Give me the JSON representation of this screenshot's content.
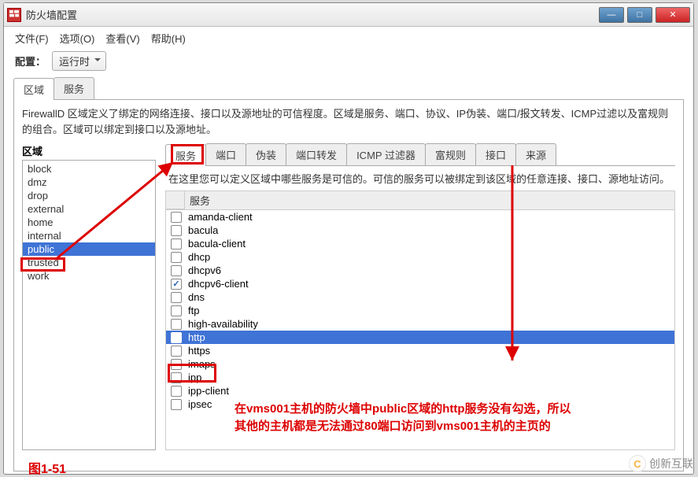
{
  "window": {
    "title": "防火墙配置"
  },
  "menu": {
    "file": "文件(F)",
    "options": "选项(O)",
    "view": "查看(V)",
    "help": "帮助(H)"
  },
  "config": {
    "label": "配置：",
    "value": "运行时"
  },
  "outer_tabs": {
    "zone": "区域",
    "service": "服务"
  },
  "description": "FirewallD 区域定义了绑定的网络连接、接口以及源地址的可信程度。区域是服务、端口、协议、IP伪装、端口/报文转发、ICMP过滤以及富规则的组合。区域可以绑定到接口以及源地址。",
  "zone": {
    "label": "区域",
    "items": [
      "block",
      "dmz",
      "drop",
      "external",
      "home",
      "internal",
      "public",
      "trusted",
      "work"
    ],
    "selected": "public"
  },
  "inner_tabs": [
    "服务",
    "端口",
    "伪装",
    "端口转发",
    "ICMP 过滤器",
    "富规则",
    "接口",
    "来源"
  ],
  "inner_selected": "服务",
  "svc_desc": "在这里您可以定义区域中哪些服务是可信的。可信的服务可以被绑定到该区域的任意连接、接口、源地址访问。",
  "svc_header": "服务",
  "services": [
    {
      "name": "amanda-client",
      "checked": false,
      "selected": false
    },
    {
      "name": "bacula",
      "checked": false,
      "selected": false
    },
    {
      "name": "bacula-client",
      "checked": false,
      "selected": false
    },
    {
      "name": "dhcp",
      "checked": false,
      "selected": false
    },
    {
      "name": "dhcpv6",
      "checked": false,
      "selected": false
    },
    {
      "name": "dhcpv6-client",
      "checked": true,
      "selected": false
    },
    {
      "name": "dns",
      "checked": false,
      "selected": false
    },
    {
      "name": "ftp",
      "checked": false,
      "selected": false
    },
    {
      "name": "high-availability",
      "checked": false,
      "selected": false
    },
    {
      "name": "http",
      "checked": false,
      "selected": true
    },
    {
      "name": "https",
      "checked": false,
      "selected": false
    },
    {
      "name": "imaps",
      "checked": false,
      "selected": false
    },
    {
      "name": "ipp",
      "checked": false,
      "selected": false
    },
    {
      "name": "ipp-client",
      "checked": false,
      "selected": false
    },
    {
      "name": "ipsec",
      "checked": false,
      "selected": false
    }
  ],
  "annotation": {
    "line1": "在vms001主机的防火墙中public区域的http服务没有勾选，所以",
    "line2": "其他的主机都是无法通过80端口访问到vms001主机的主页的",
    "figure": "图1-51"
  },
  "watermark": {
    "logo": "C",
    "text": "创新互联"
  }
}
